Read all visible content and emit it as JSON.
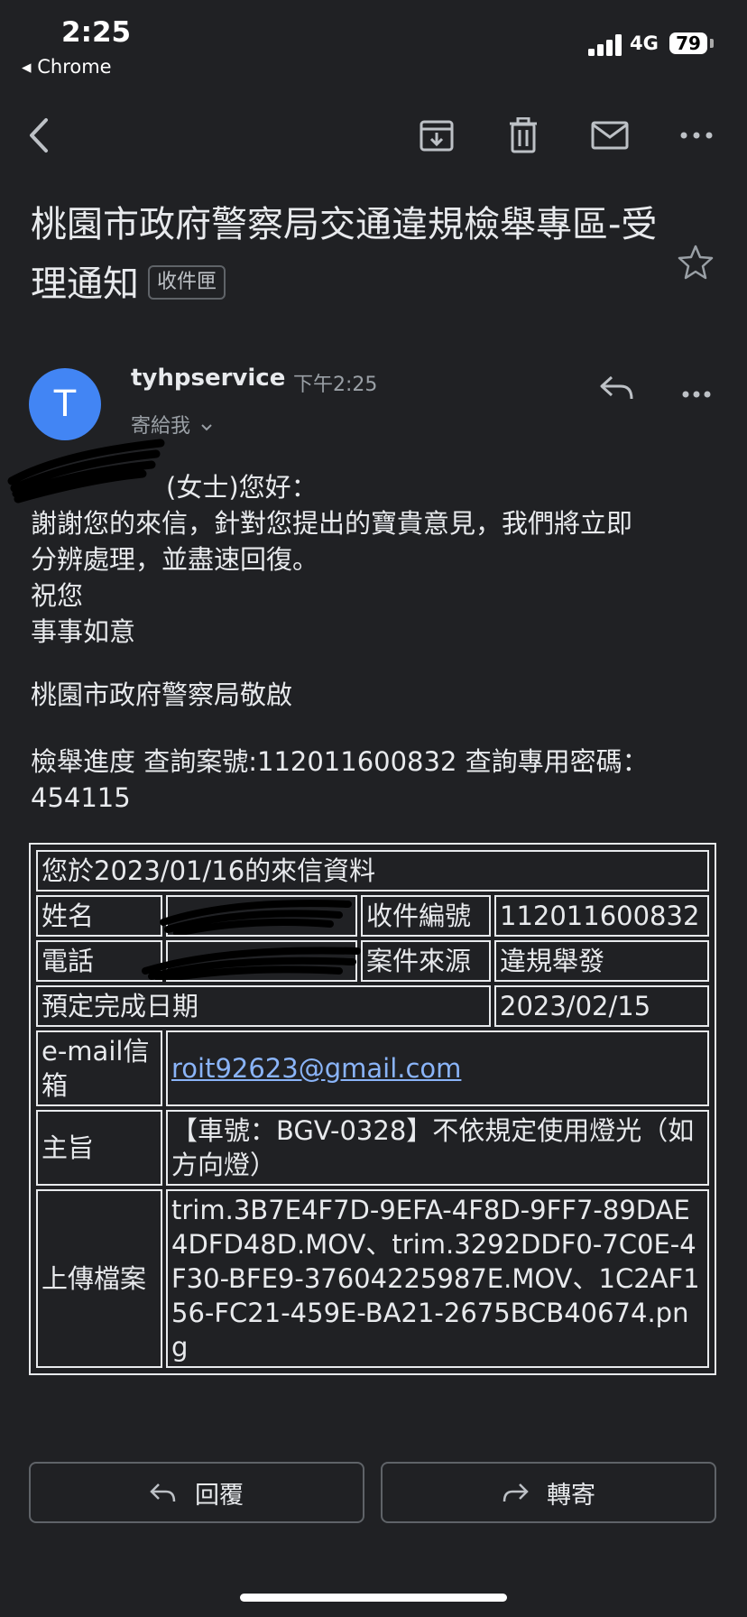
{
  "status_bar": {
    "time": "2:25",
    "back_app": "◂ Chrome",
    "network": "4G",
    "battery": "79"
  },
  "toolbar": {
    "icons": [
      "back-arrow-icon",
      "archive-icon",
      "delete-icon",
      "mark-unread-icon",
      "more-icon"
    ]
  },
  "email": {
    "subject": "桃園市政府警察局交通違規檢舉專區-受理通知",
    "label": "收件匣",
    "sender": "tyhpservice",
    "time": "下午2:25",
    "to": "寄給我",
    "avatar_letter": "T",
    "avatar_color": "#4285f4"
  },
  "body": {
    "greeting": "(女士)您好：",
    "line1": "謝謝您的來信，針對您提出的寶貴意見，我們將立即",
    "line2": "分辨處理，並盡速回復。",
    "line3": "祝您",
    "line4": "事事如意",
    "signature": "桃園市政府警察局敬啟",
    "progress_line1": "檢舉進度 查詢案號:112011600832 查詢專用密碼：",
    "progress_line2": "454115"
  },
  "table": {
    "header": "您於2023/01/16的來信資料",
    "name_label": "姓名",
    "receipt_label": "收件編號",
    "receipt_value": "112011600832",
    "phone_label": "電話",
    "source_label": "案件來源",
    "source_value": "違規舉發",
    "due_label": "預定完成日期",
    "due_value": "2023/02/15",
    "email_label": "e-mail信箱",
    "email_value": "roit92623@gmail.com",
    "subject_label": "主旨",
    "subject_value": "【車號：BGV-0328】不依規定使用燈光（如方向燈）",
    "files_label": "上傳檔案",
    "files_value": "trim.3B7E4F7D-9EFA-4F8D-9FF7-89DAE4DFD48D.MOV、trim.3292DDF0-7C0E-4F30-BFE9-37604225987E.MOV、1C2AF156-FC21-459E-BA21-2675BCB40674.png"
  },
  "actions": {
    "reply": "回覆",
    "forward": "轉寄"
  }
}
